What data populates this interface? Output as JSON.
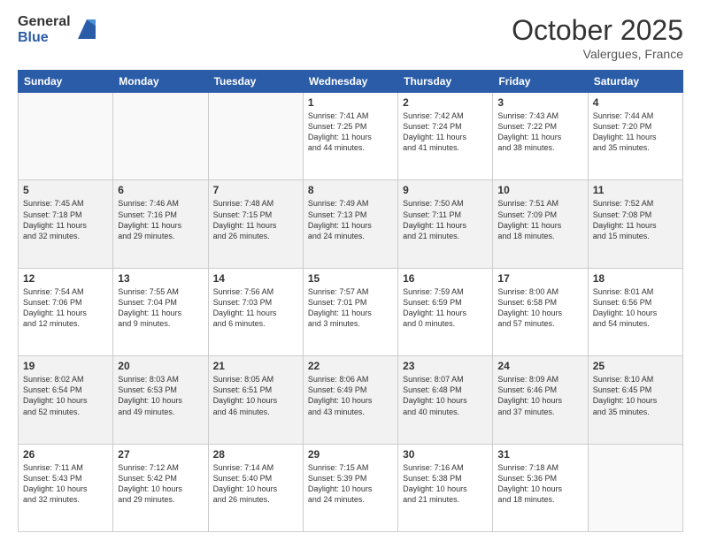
{
  "logo": {
    "line1": "General",
    "line2": "Blue"
  },
  "title": "October 2025",
  "location": "Valergues, France",
  "days_header": [
    "Sunday",
    "Monday",
    "Tuesday",
    "Wednesday",
    "Thursday",
    "Friday",
    "Saturday"
  ],
  "weeks": [
    [
      {
        "day": "",
        "info": ""
      },
      {
        "day": "",
        "info": ""
      },
      {
        "day": "",
        "info": ""
      },
      {
        "day": "1",
        "info": "Sunrise: 7:41 AM\nSunset: 7:25 PM\nDaylight: 11 hours\nand 44 minutes."
      },
      {
        "day": "2",
        "info": "Sunrise: 7:42 AM\nSunset: 7:24 PM\nDaylight: 11 hours\nand 41 minutes."
      },
      {
        "day": "3",
        "info": "Sunrise: 7:43 AM\nSunset: 7:22 PM\nDaylight: 11 hours\nand 38 minutes."
      },
      {
        "day": "4",
        "info": "Sunrise: 7:44 AM\nSunset: 7:20 PM\nDaylight: 11 hours\nand 35 minutes."
      }
    ],
    [
      {
        "day": "5",
        "info": "Sunrise: 7:45 AM\nSunset: 7:18 PM\nDaylight: 11 hours\nand 32 minutes."
      },
      {
        "day": "6",
        "info": "Sunrise: 7:46 AM\nSunset: 7:16 PM\nDaylight: 11 hours\nand 29 minutes."
      },
      {
        "day": "7",
        "info": "Sunrise: 7:48 AM\nSunset: 7:15 PM\nDaylight: 11 hours\nand 26 minutes."
      },
      {
        "day": "8",
        "info": "Sunrise: 7:49 AM\nSunset: 7:13 PM\nDaylight: 11 hours\nand 24 minutes."
      },
      {
        "day": "9",
        "info": "Sunrise: 7:50 AM\nSunset: 7:11 PM\nDaylight: 11 hours\nand 21 minutes."
      },
      {
        "day": "10",
        "info": "Sunrise: 7:51 AM\nSunset: 7:09 PM\nDaylight: 11 hours\nand 18 minutes."
      },
      {
        "day": "11",
        "info": "Sunrise: 7:52 AM\nSunset: 7:08 PM\nDaylight: 11 hours\nand 15 minutes."
      }
    ],
    [
      {
        "day": "12",
        "info": "Sunrise: 7:54 AM\nSunset: 7:06 PM\nDaylight: 11 hours\nand 12 minutes."
      },
      {
        "day": "13",
        "info": "Sunrise: 7:55 AM\nSunset: 7:04 PM\nDaylight: 11 hours\nand 9 minutes."
      },
      {
        "day": "14",
        "info": "Sunrise: 7:56 AM\nSunset: 7:03 PM\nDaylight: 11 hours\nand 6 minutes."
      },
      {
        "day": "15",
        "info": "Sunrise: 7:57 AM\nSunset: 7:01 PM\nDaylight: 11 hours\nand 3 minutes."
      },
      {
        "day": "16",
        "info": "Sunrise: 7:59 AM\nSunset: 6:59 PM\nDaylight: 11 hours\nand 0 minutes."
      },
      {
        "day": "17",
        "info": "Sunrise: 8:00 AM\nSunset: 6:58 PM\nDaylight: 10 hours\nand 57 minutes."
      },
      {
        "day": "18",
        "info": "Sunrise: 8:01 AM\nSunset: 6:56 PM\nDaylight: 10 hours\nand 54 minutes."
      }
    ],
    [
      {
        "day": "19",
        "info": "Sunrise: 8:02 AM\nSunset: 6:54 PM\nDaylight: 10 hours\nand 52 minutes."
      },
      {
        "day": "20",
        "info": "Sunrise: 8:03 AM\nSunset: 6:53 PM\nDaylight: 10 hours\nand 49 minutes."
      },
      {
        "day": "21",
        "info": "Sunrise: 8:05 AM\nSunset: 6:51 PM\nDaylight: 10 hours\nand 46 minutes."
      },
      {
        "day": "22",
        "info": "Sunrise: 8:06 AM\nSunset: 6:49 PM\nDaylight: 10 hours\nand 43 minutes."
      },
      {
        "day": "23",
        "info": "Sunrise: 8:07 AM\nSunset: 6:48 PM\nDaylight: 10 hours\nand 40 minutes."
      },
      {
        "day": "24",
        "info": "Sunrise: 8:09 AM\nSunset: 6:46 PM\nDaylight: 10 hours\nand 37 minutes."
      },
      {
        "day": "25",
        "info": "Sunrise: 8:10 AM\nSunset: 6:45 PM\nDaylight: 10 hours\nand 35 minutes."
      }
    ],
    [
      {
        "day": "26",
        "info": "Sunrise: 7:11 AM\nSunset: 5:43 PM\nDaylight: 10 hours\nand 32 minutes."
      },
      {
        "day": "27",
        "info": "Sunrise: 7:12 AM\nSunset: 5:42 PM\nDaylight: 10 hours\nand 29 minutes."
      },
      {
        "day": "28",
        "info": "Sunrise: 7:14 AM\nSunset: 5:40 PM\nDaylight: 10 hours\nand 26 minutes."
      },
      {
        "day": "29",
        "info": "Sunrise: 7:15 AM\nSunset: 5:39 PM\nDaylight: 10 hours\nand 24 minutes."
      },
      {
        "day": "30",
        "info": "Sunrise: 7:16 AM\nSunset: 5:38 PM\nDaylight: 10 hours\nand 21 minutes."
      },
      {
        "day": "31",
        "info": "Sunrise: 7:18 AM\nSunset: 5:36 PM\nDaylight: 10 hours\nand 18 minutes."
      },
      {
        "day": "",
        "info": ""
      }
    ]
  ]
}
